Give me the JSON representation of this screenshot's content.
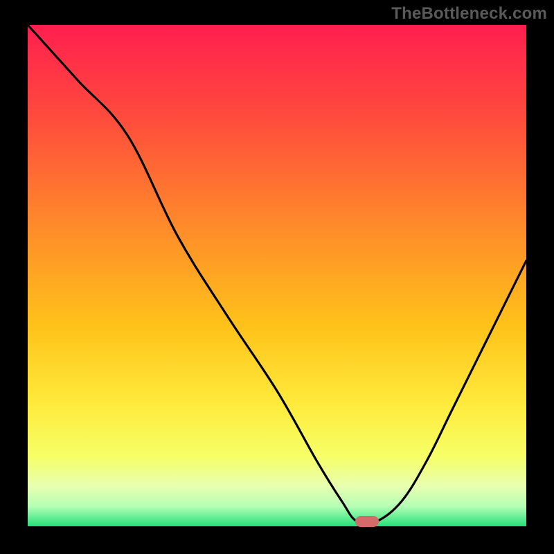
{
  "watermark": "TheBottleneck.com",
  "colors": {
    "frame_bg": "#000000",
    "watermark": "#5a5a5a",
    "curve": "#000000",
    "marker": "#d46a6a"
  },
  "chart_data": {
    "type": "line",
    "title": "",
    "xlabel": "",
    "ylabel": "",
    "xlim": [
      0,
      100
    ],
    "ylim": [
      0,
      100
    ],
    "grid": false,
    "series": [
      {
        "name": "bottleneck-curve",
        "x": [
          0,
          10,
          20,
          30,
          40,
          50,
          58,
          63,
          66,
          70,
          75,
          80,
          85,
          90,
          95,
          100
        ],
        "values": [
          100,
          89,
          78,
          58,
          42,
          27,
          13,
          5,
          1,
          1,
          5,
          13,
          23,
          33,
          43,
          53
        ]
      }
    ],
    "marker": {
      "x": 68,
      "y": 1
    },
    "gradient_stops": [
      {
        "offset": 0.0,
        "color": "#ff1f4f"
      },
      {
        "offset": 0.18,
        "color": "#ff4a3d"
      },
      {
        "offset": 0.4,
        "color": "#ff8a2a"
      },
      {
        "offset": 0.6,
        "color": "#ffc21a"
      },
      {
        "offset": 0.75,
        "color": "#ffe93a"
      },
      {
        "offset": 0.86,
        "color": "#f6ff66"
      },
      {
        "offset": 0.92,
        "color": "#e8ffb0"
      },
      {
        "offset": 0.96,
        "color": "#b5ffb5"
      },
      {
        "offset": 1.0,
        "color": "#25e07a"
      }
    ]
  }
}
